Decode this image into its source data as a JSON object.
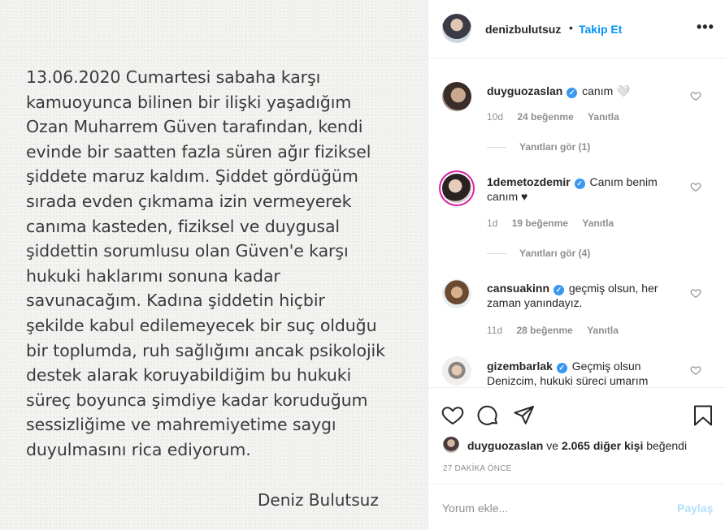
{
  "post": {
    "lines": [
      "13.06.2020 Cumartesi sabaha karşı",
      "kamuoyunca bilinen bir ilişki yaşadığım",
      "Ozan Muharrem Güven tarafından, kendi",
      "evinde bir saatten fazla süren ağır fiziksel",
      "şiddete maruz kaldım. Şiddet gördüğüm",
      "sırada evden çıkmama izin vermeyerek",
      "canıma kasteden, fiziksel ve duygusal",
      "şiddettin sorumlusu olan Güven'e karşı",
      "hukuki haklarımı sonuna kadar",
      "savunacağım. Kadına şiddetin hiçbir",
      "şekilde kabul edilemeyecek bir suç olduğu",
      "bir toplumda, ruh sağlığımı ancak psikolojik",
      "destek alarak koruyabildiğim bu hukuki",
      "süreç boyunca şimdiye kadar koruduğum",
      "sessizliğime ve mahremiyetime saygı",
      "duyulmasını rica ediyorum."
    ],
    "signature": "Deniz Bulutsuz"
  },
  "header": {
    "username": "denizbulutsuz",
    "dot": "•",
    "follow_label": "Takip Et",
    "more_label": "•••"
  },
  "comments": [
    {
      "username": "duyguozaslan",
      "text": "canım 🤍",
      "time": "10d",
      "likes": "24 beğenme",
      "reply": "Yanıtla",
      "view_replies": "Yanıtları gör (1)"
    },
    {
      "username": "1demetozdemir",
      "text": "Canım benim canım ♥",
      "time": "1d",
      "likes": "19 beğenme",
      "reply": "Yanıtla",
      "view_replies": "Yanıtları gör (4)"
    },
    {
      "username": "cansuakinn",
      "text": "geçmiş olsun, her zaman yanındayız.",
      "time": "11d",
      "likes": "28 beğenme",
      "reply": "Yanıtla"
    },
    {
      "username": "gizembarlak",
      "text": "Geçmiş olsun Denizcim, hukuki süreci umarım"
    }
  ],
  "likes": {
    "user": "duyguozaslan",
    "middle": "ve",
    "others": "2.065 diğer kişi",
    "suffix": "beğendi"
  },
  "timestamp": "27 DAKİKA ÖNCE",
  "add_comment": {
    "placeholder": "Yorum ekle...",
    "post_label": "Paylaş"
  },
  "colors": {
    "link_blue": "#0095f6",
    "verified_blue": "#3897f0",
    "post_disabled": "#b2dffc",
    "muted": "#8e8e8e"
  },
  "icons": [
    "more-options-icon",
    "verified-icon",
    "heart-icon",
    "comment-icon",
    "share-icon",
    "bookmark-icon"
  ]
}
